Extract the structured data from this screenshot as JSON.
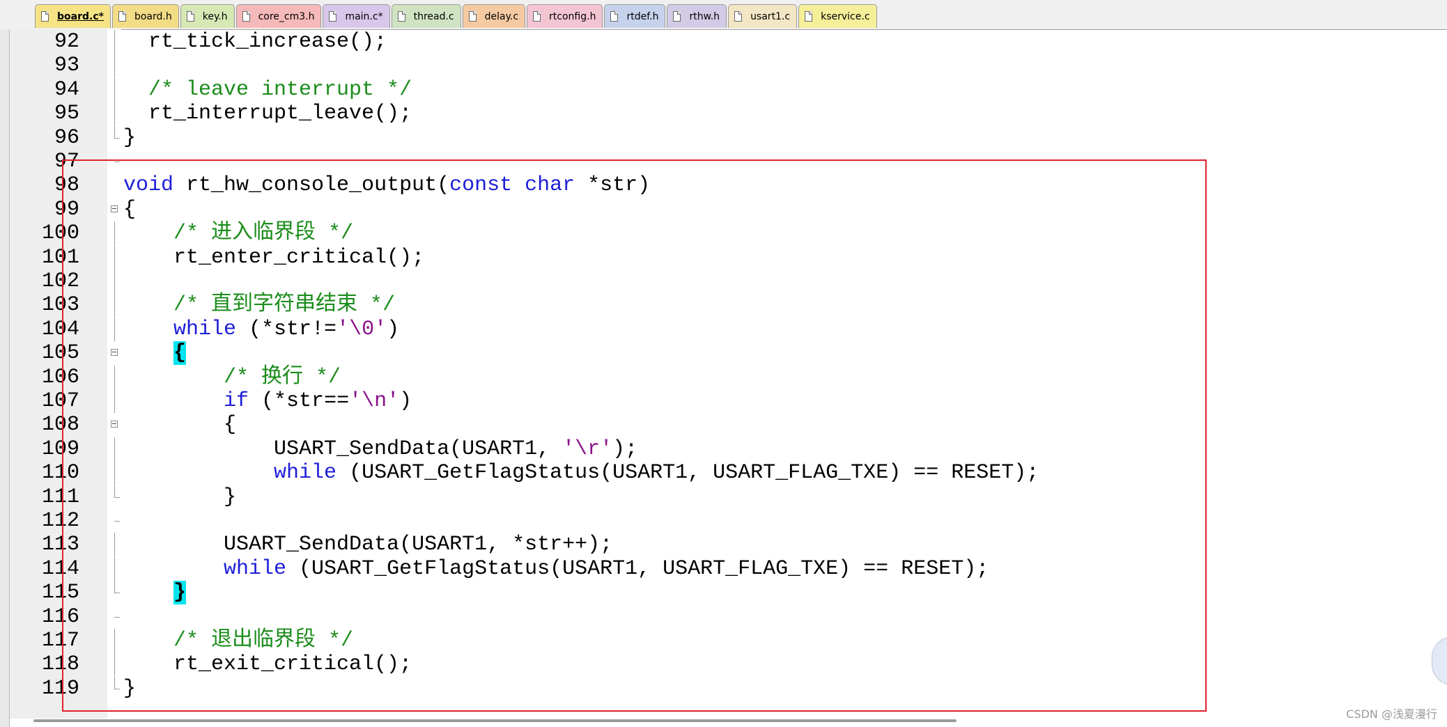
{
  "tabs": [
    {
      "label": "board.c*",
      "active": true,
      "color": "#f5e386"
    },
    {
      "label": "board.h",
      "active": false,
      "color": "#f2dc86"
    },
    {
      "label": "key.h",
      "active": false,
      "color": "#d6e8b4"
    },
    {
      "label": "core_cm3.h",
      "active": false,
      "color": "#f6b9b9"
    },
    {
      "label": "main.c*",
      "active": false,
      "color": "#d8c7ea"
    },
    {
      "label": "thread.c",
      "active": false,
      "color": "#cfe3c2"
    },
    {
      "label": "delay.c",
      "active": false,
      "color": "#f5caa2"
    },
    {
      "label": "rtconfig.h",
      "active": false,
      "color": "#f3c4d2"
    },
    {
      "label": "rtdef.h",
      "active": false,
      "color": "#c6d2ec"
    },
    {
      "label": "rthw.h",
      "active": false,
      "color": "#d3cbe5"
    },
    {
      "label": "usart1.c",
      "active": false,
      "color": "#f3e6c4"
    },
    {
      "label": "kservice.c",
      "active": false,
      "color": "#f5ef9a"
    }
  ],
  "code_lines": [
    {
      "num": "92",
      "fold": "line",
      "segments": [
        {
          "t": "  rt_tick_increase();",
          "c": ""
        }
      ]
    },
    {
      "num": "93",
      "fold": "line",
      "segments": []
    },
    {
      "num": "94",
      "fold": "line",
      "segments": [
        {
          "t": "  /* leave interrupt */",
          "c": "cm"
        }
      ]
    },
    {
      "num": "95",
      "fold": "line",
      "segments": [
        {
          "t": "  rt_interrupt_leave();",
          "c": ""
        }
      ]
    },
    {
      "num": "96",
      "fold": "end",
      "segments": [
        {
          "t": "}",
          "c": ""
        }
      ]
    },
    {
      "num": "97",
      "fold": "tick",
      "segments": []
    },
    {
      "num": "98",
      "fold": "",
      "segments": [
        {
          "t": "void",
          "c": "kw"
        },
        {
          "t": " rt_hw_console_output(",
          "c": ""
        },
        {
          "t": "const",
          "c": "kw"
        },
        {
          "t": " ",
          "c": ""
        },
        {
          "t": "char",
          "c": "kw"
        },
        {
          "t": " *str)",
          "c": ""
        }
      ]
    },
    {
      "num": "99",
      "fold": "box",
      "segments": [
        {
          "t": "{",
          "c": ""
        }
      ]
    },
    {
      "num": "100",
      "fold": "line",
      "segments": [
        {
          "t": "    ",
          "c": ""
        },
        {
          "t": "/* 进入临界段 */",
          "c": "cm"
        }
      ]
    },
    {
      "num": "101",
      "fold": "line",
      "segments": [
        {
          "t": "    rt_enter_critical();",
          "c": ""
        }
      ]
    },
    {
      "num": "102",
      "fold": "line",
      "segments": []
    },
    {
      "num": "103",
      "fold": "line",
      "segments": [
        {
          "t": "    ",
          "c": ""
        },
        {
          "t": "/* 直到字符串结束 */",
          "c": "cm"
        }
      ]
    },
    {
      "num": "104",
      "fold": "line",
      "segments": [
        {
          "t": "    ",
          "c": ""
        },
        {
          "t": "while",
          "c": "kw"
        },
        {
          "t": " (*str!=",
          "c": ""
        },
        {
          "t": "'\\0'",
          "c": "str"
        },
        {
          "t": ")",
          "c": ""
        }
      ]
    },
    {
      "num": "105",
      "fold": "box",
      "segments": [
        {
          "t": "    ",
          "c": ""
        },
        {
          "t": "{",
          "c": "hl"
        }
      ]
    },
    {
      "num": "106",
      "fold": "line",
      "segments": [
        {
          "t": "        ",
          "c": ""
        },
        {
          "t": "/* 换行 */",
          "c": "cm"
        }
      ]
    },
    {
      "num": "107",
      "fold": "line",
      "segments": [
        {
          "t": "        ",
          "c": ""
        },
        {
          "t": "if",
          "c": "kw"
        },
        {
          "t": " (*str==",
          "c": ""
        },
        {
          "t": "'\\n'",
          "c": "str"
        },
        {
          "t": ")",
          "c": ""
        }
      ]
    },
    {
      "num": "108",
      "fold": "box",
      "segments": [
        {
          "t": "        {",
          "c": ""
        }
      ]
    },
    {
      "num": "109",
      "fold": "line",
      "segments": [
        {
          "t": "            USART_SendData(USART1, ",
          "c": ""
        },
        {
          "t": "'\\r'",
          "c": "str"
        },
        {
          "t": ");",
          "c": ""
        }
      ]
    },
    {
      "num": "110",
      "fold": "line",
      "segments": [
        {
          "t": "            ",
          "c": ""
        },
        {
          "t": "while",
          "c": "kw"
        },
        {
          "t": " (USART_GetFlagStatus(USART1, USART_FLAG_TXE) == RESET);",
          "c": ""
        }
      ]
    },
    {
      "num": "111",
      "fold": "end",
      "segments": [
        {
          "t": "        }",
          "c": ""
        }
      ]
    },
    {
      "num": "112",
      "fold": "tick",
      "segments": []
    },
    {
      "num": "113",
      "fold": "line",
      "segments": [
        {
          "t": "        USART_SendData(USART1, *str++);",
          "c": ""
        }
      ]
    },
    {
      "num": "114",
      "fold": "line",
      "segments": [
        {
          "t": "        ",
          "c": ""
        },
        {
          "t": "while",
          "c": "kw"
        },
        {
          "t": " (USART_GetFlagStatus(USART1, USART_FLAG_TXE) == RESET);",
          "c": ""
        }
      ]
    },
    {
      "num": "115",
      "fold": "end",
      "segments": [
        {
          "t": "    ",
          "c": ""
        },
        {
          "t": "}",
          "c": "hl"
        }
      ]
    },
    {
      "num": "116",
      "fold": "tick",
      "segments": []
    },
    {
      "num": "117",
      "fold": "line",
      "segments": [
        {
          "t": "    ",
          "c": ""
        },
        {
          "t": "/* 退出临界段 */",
          "c": "cm"
        }
      ]
    },
    {
      "num": "118",
      "fold": "line",
      "segments": [
        {
          "t": "    rt_exit_critical();",
          "c": ""
        }
      ]
    },
    {
      "num": "119",
      "fold": "end",
      "segments": [
        {
          "t": "}",
          "c": ""
        }
      ]
    }
  ],
  "watermark": "CSDN @浅夏漫行",
  "colors": {
    "keyword": "#1d1dd8",
    "comment": "#1a8c1a",
    "char_literal": "#8a128a",
    "brace_highlight": "#00e5ee",
    "annotation_box": "#e0222a"
  }
}
